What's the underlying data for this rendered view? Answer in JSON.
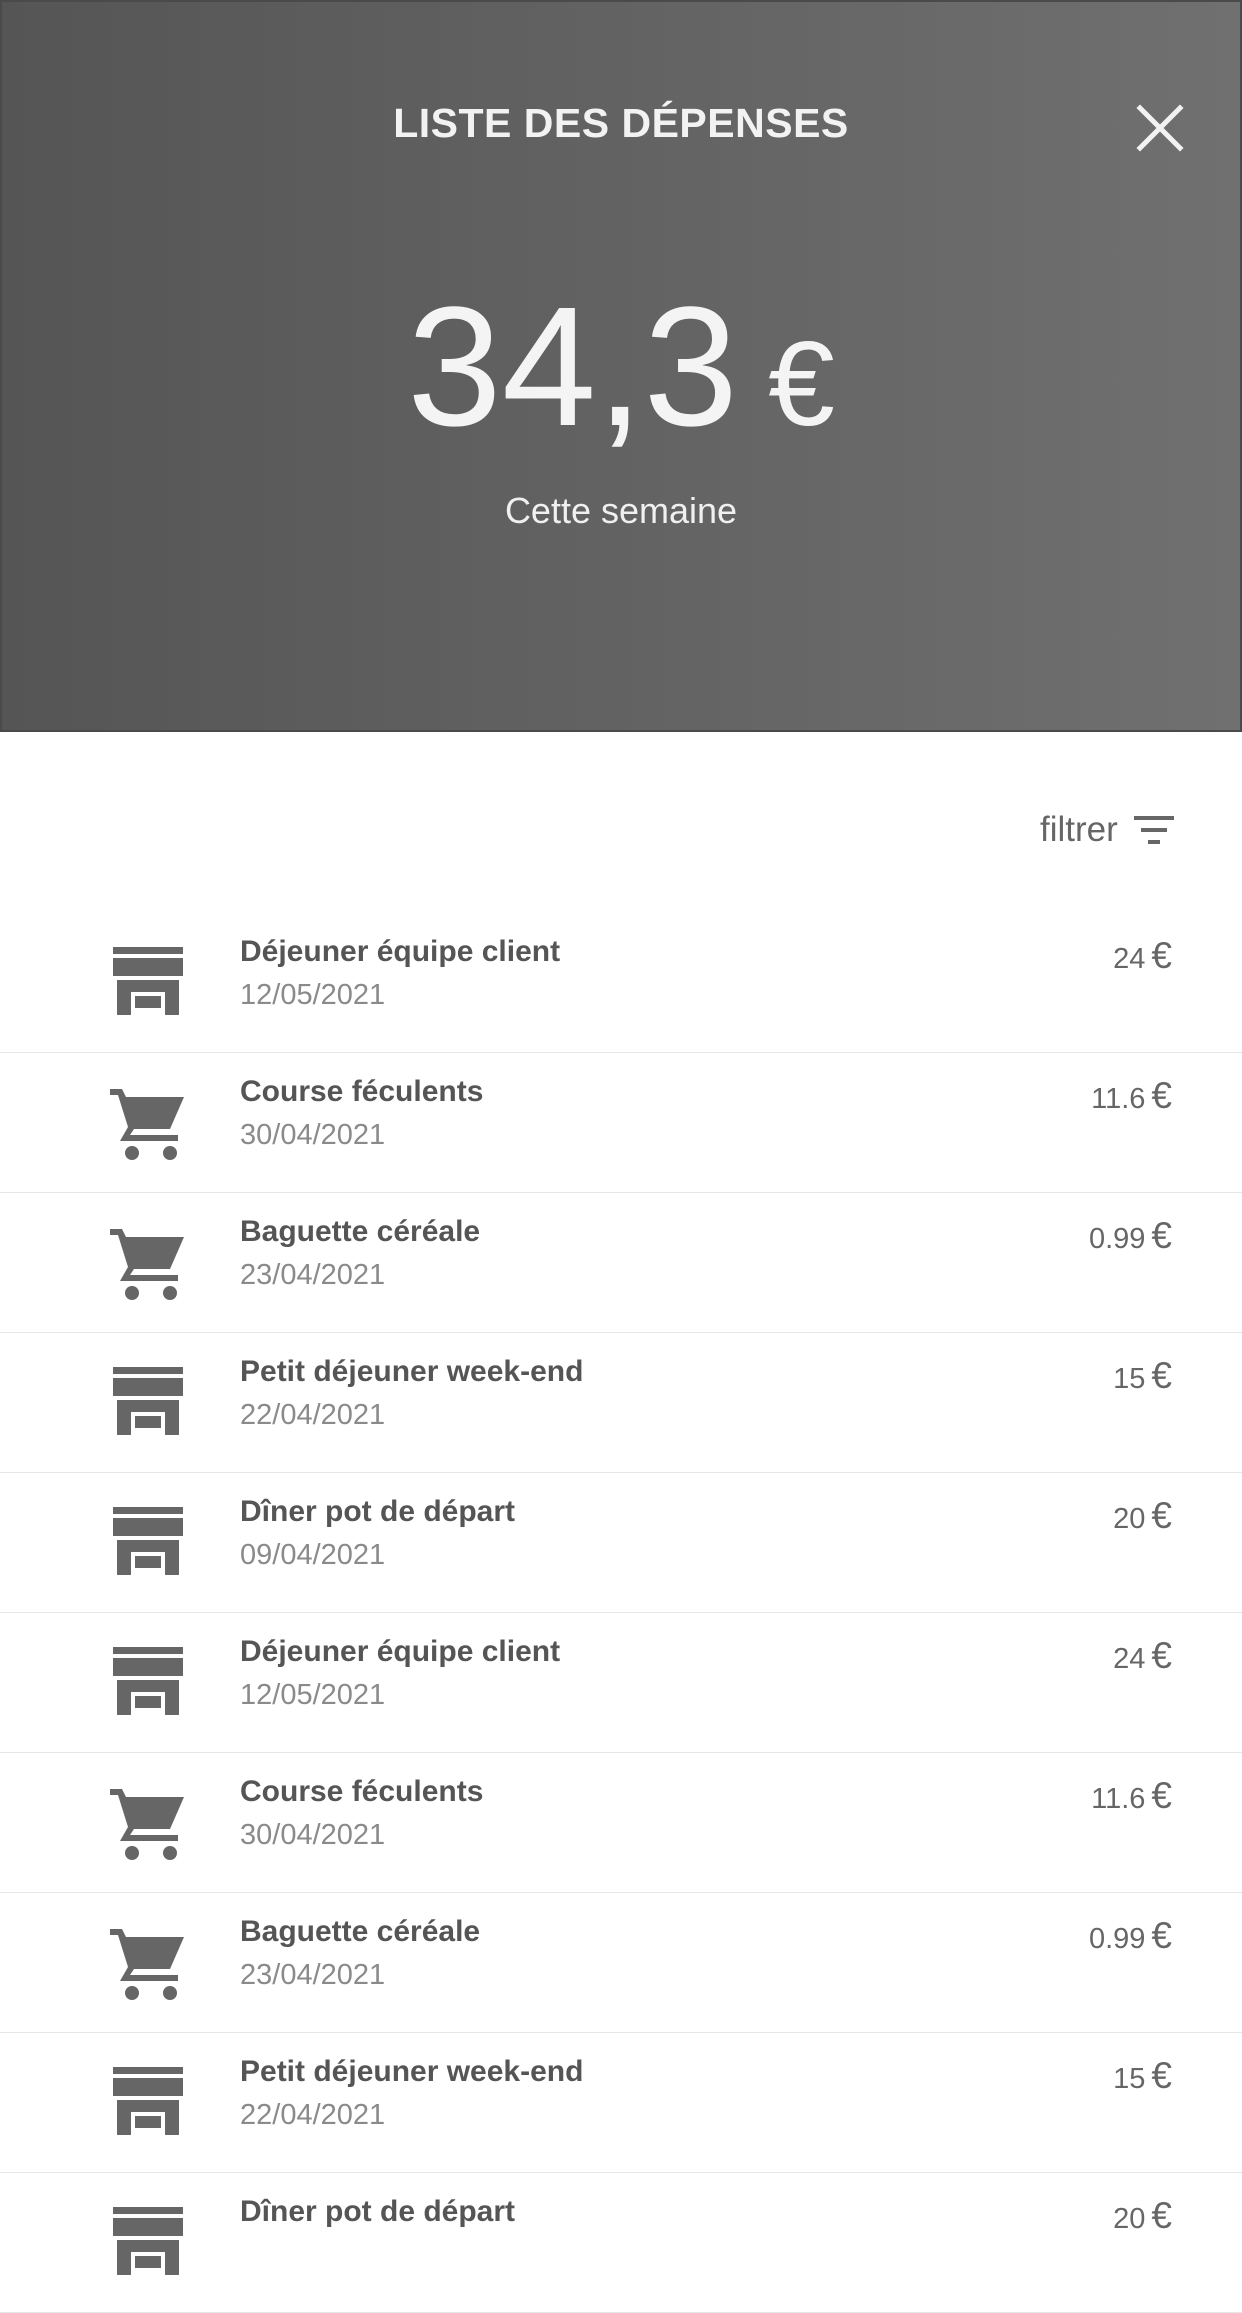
{
  "header": {
    "title": "LISTE DES DÉPENSES",
    "total_value": "34,3",
    "currency_symbol": "€",
    "period_label": "Cette semaine",
    "close_icon": "close-icon",
    "background_start": "#555555",
    "background_end": "#707070"
  },
  "filter": {
    "label": "filtrer",
    "icon": "filter-icon"
  },
  "expenses": [
    {
      "name": "Déjeuner équipe client",
      "date": "12/05/2021",
      "amount": "24",
      "currency": "€",
      "icon": "store-icon"
    },
    {
      "name": "Course féculents",
      "date": "30/04/2021",
      "amount": "11.6",
      "currency": "€",
      "icon": "cart-icon"
    },
    {
      "name": "Baguette céréale",
      "date": "23/04/2021",
      "amount": "0.99",
      "currency": "€",
      "icon": "cart-icon"
    },
    {
      "name": "Petit déjeuner week-end",
      "date": "22/04/2021",
      "amount": "15",
      "currency": "€",
      "icon": "store-icon"
    },
    {
      "name": "Dîner pot de départ",
      "date": "09/04/2021",
      "amount": "20",
      "currency": "€",
      "icon": "store-icon"
    },
    {
      "name": "Déjeuner équipe client",
      "date": "12/05/2021",
      "amount": "24",
      "currency": "€",
      "icon": "store-icon"
    },
    {
      "name": "Course féculents",
      "date": "30/04/2021",
      "amount": "11.6",
      "currency": "€",
      "icon": "cart-icon"
    },
    {
      "name": "Baguette céréale",
      "date": "23/04/2021",
      "amount": "0.99",
      "currency": "€",
      "icon": "cart-icon"
    },
    {
      "name": "Petit déjeuner week-end",
      "date": "22/04/2021",
      "amount": "15",
      "currency": "€",
      "icon": "store-icon"
    },
    {
      "name": "Dîner pot de départ",
      "date": "",
      "amount": "20",
      "currency": "€",
      "icon": "store-icon"
    }
  ]
}
